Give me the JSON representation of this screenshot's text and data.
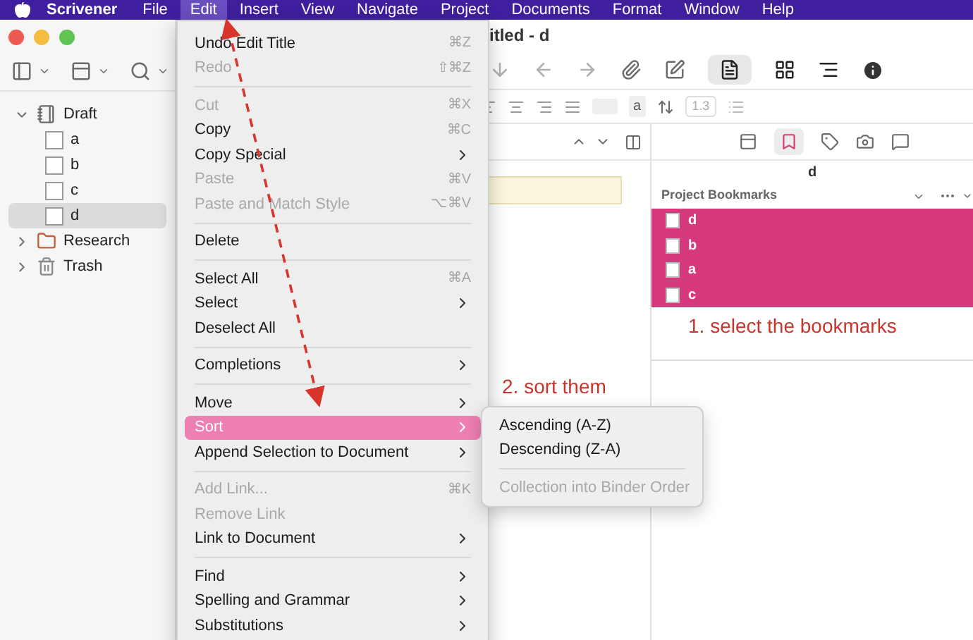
{
  "menubar": {
    "app": "Scrivener",
    "items": [
      {
        "label": "File",
        "selected": false
      },
      {
        "label": "Edit",
        "selected": true
      },
      {
        "label": "Insert",
        "selected": false
      },
      {
        "label": "View",
        "selected": false
      },
      {
        "label": "Navigate",
        "selected": false
      },
      {
        "label": "Project",
        "selected": false
      },
      {
        "label": "Documents",
        "selected": false
      },
      {
        "label": "Format",
        "selected": false
      },
      {
        "label": "Window",
        "selected": false
      },
      {
        "label": "Help",
        "selected": false
      }
    ]
  },
  "window": {
    "title": "itled - d"
  },
  "format_bar": {
    "font_style": "a",
    "line_spacing": "1.3"
  },
  "binder": [
    {
      "label": "Draft",
      "kind": "draft",
      "expanded": true,
      "selected": false,
      "children": [
        {
          "label": "a",
          "kind": "doc",
          "selected": false
        },
        {
          "label": "b",
          "kind": "doc",
          "selected": false
        },
        {
          "label": "c",
          "kind": "doc",
          "selected": false
        },
        {
          "label": "d",
          "kind": "doc",
          "selected": true
        }
      ]
    },
    {
      "label": "Research",
      "kind": "research",
      "expanded": false,
      "selected": false
    },
    {
      "label": "Trash",
      "kind": "trash",
      "expanded": false,
      "selected": false
    }
  ],
  "inspector": {
    "document_title": "d",
    "bookmarks_header": "Project Bookmarks",
    "bookmarks": [
      {
        "label": "d",
        "selected": true
      },
      {
        "label": "b",
        "selected": true
      },
      {
        "label": "a",
        "selected": true
      },
      {
        "label": "c",
        "selected": true
      }
    ]
  },
  "edit_menu": [
    {
      "kind": "item",
      "label": "Undo Edit Title",
      "shortcut": "⌘Z",
      "disabled": false,
      "submenu": false,
      "selected": false
    },
    {
      "kind": "item",
      "label": "Redo",
      "shortcut": "⇧⌘Z",
      "disabled": true,
      "submenu": false,
      "selected": false
    },
    {
      "kind": "separator"
    },
    {
      "kind": "item",
      "label": "Cut",
      "shortcut": "⌘X",
      "disabled": true,
      "submenu": false,
      "selected": false
    },
    {
      "kind": "item",
      "label": "Copy",
      "shortcut": "⌘C",
      "disabled": false,
      "submenu": false,
      "selected": false
    },
    {
      "kind": "item",
      "label": "Copy Special",
      "disabled": false,
      "submenu": true,
      "selected": false
    },
    {
      "kind": "item",
      "label": "Paste",
      "shortcut": "⌘V",
      "disabled": true,
      "submenu": false,
      "selected": false
    },
    {
      "kind": "item",
      "label": "Paste and Match Style",
      "shortcut": "⌥⌘V",
      "disabled": true,
      "submenu": false,
      "selected": false
    },
    {
      "kind": "separator"
    },
    {
      "kind": "item",
      "label": "Delete",
      "disabled": false,
      "submenu": false,
      "selected": false
    },
    {
      "kind": "separator"
    },
    {
      "kind": "item",
      "label": "Select All",
      "shortcut": "⌘A",
      "disabled": false,
      "submenu": false,
      "selected": false
    },
    {
      "kind": "item",
      "label": "Select",
      "disabled": false,
      "submenu": true,
      "selected": false
    },
    {
      "kind": "item",
      "label": "Deselect All",
      "disabled": false,
      "submenu": false,
      "selected": false
    },
    {
      "kind": "separator"
    },
    {
      "kind": "item",
      "label": "Completions",
      "disabled": false,
      "submenu": true,
      "selected": false
    },
    {
      "kind": "separator"
    },
    {
      "kind": "item",
      "label": "Move",
      "disabled": false,
      "submenu": true,
      "selected": false
    },
    {
      "kind": "item",
      "label": "Sort",
      "disabled": false,
      "submenu": true,
      "selected": true
    },
    {
      "kind": "item",
      "label": "Append Selection to Document",
      "disabled": false,
      "submenu": true,
      "selected": false
    },
    {
      "kind": "separator"
    },
    {
      "kind": "item",
      "label": "Add Link...",
      "shortcut": "⌘K",
      "disabled": true,
      "submenu": false,
      "selected": false
    },
    {
      "kind": "item",
      "label": "Remove Link",
      "disabled": true,
      "submenu": false,
      "selected": false
    },
    {
      "kind": "item",
      "label": "Link to Document",
      "disabled": false,
      "submenu": true,
      "selected": false
    },
    {
      "kind": "separator"
    },
    {
      "kind": "item",
      "label": "Find",
      "disabled": false,
      "submenu": true,
      "selected": false
    },
    {
      "kind": "item",
      "label": "Spelling and Grammar",
      "disabled": false,
      "submenu": true,
      "selected": false
    },
    {
      "kind": "item",
      "label": "Substitutions",
      "disabled": false,
      "submenu": true,
      "selected": false
    }
  ],
  "sort_submenu": [
    {
      "kind": "item",
      "label": "Ascending (A-Z)",
      "disabled": false
    },
    {
      "kind": "item",
      "label": "Descending (Z-A)",
      "disabled": false
    },
    {
      "kind": "separator"
    },
    {
      "kind": "item",
      "label": "Collection into Binder Order",
      "disabled": true
    }
  ],
  "annotations": [
    "1. select the bookmarks",
    "2. sort them"
  ]
}
